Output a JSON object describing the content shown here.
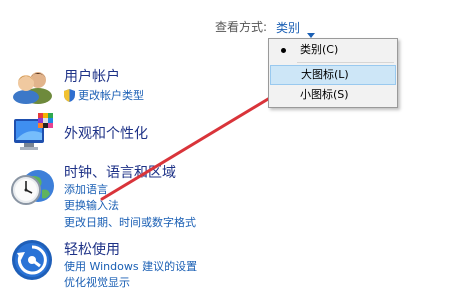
{
  "view_by": {
    "label": "查看方式:",
    "value": "类别",
    "menu": {
      "items": [
        {
          "label": "类别(C)",
          "selected": true
        },
        {
          "label": "大图标(L)",
          "highlighted": true
        },
        {
          "label": "小图标(S)"
        }
      ]
    }
  },
  "categories": [
    {
      "title": "用户帐户",
      "icon": "user-accounts-icon",
      "links": [
        "更改帐户类型"
      ]
    },
    {
      "title": "外观和个性化",
      "icon": "appearance-icon",
      "links": []
    },
    {
      "title": "时钟、语言和区域",
      "icon": "clock-globe-icon",
      "links": [
        "添加语言",
        "更换输入法",
        "更改日期、时间或数字格式"
      ]
    },
    {
      "title": "轻松使用",
      "icon": "ease-of-access-icon",
      "links": [
        "使用 Windows 建议的设置",
        "优化视觉显示"
      ]
    }
  ],
  "colors": {
    "category_title": "#1e3287",
    "link": "#1a5fb4",
    "annotation_arrow": "#d9343a"
  }
}
